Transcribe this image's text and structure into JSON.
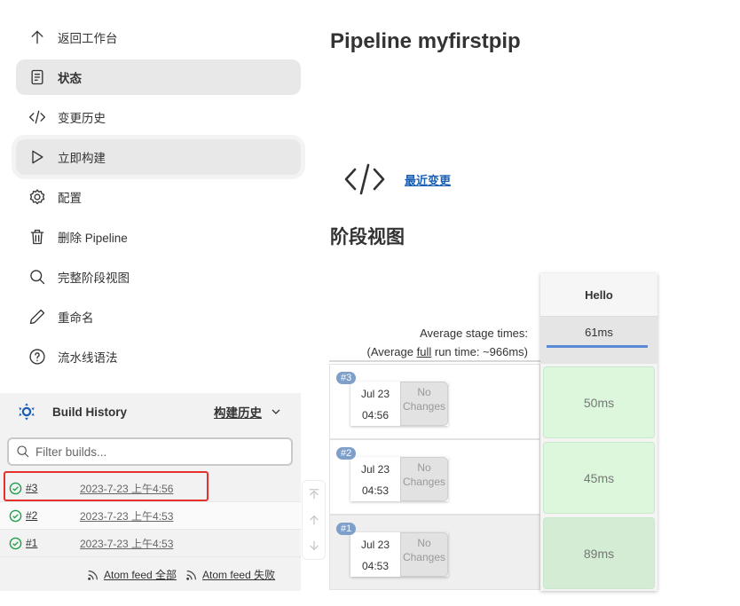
{
  "sidebar": {
    "items": [
      {
        "label": "返回工作台",
        "icon": "arrow-up-icon"
      },
      {
        "label": "状态",
        "icon": "document-icon",
        "active": true
      },
      {
        "label": "变更历史",
        "icon": "code-icon"
      },
      {
        "label": "立即构建",
        "icon": "play-icon"
      },
      {
        "label": "配置",
        "icon": "gear-icon"
      },
      {
        "label": "删除 Pipeline",
        "icon": "trash-icon"
      },
      {
        "label": "完整阶段视图",
        "icon": "search-icon"
      },
      {
        "label": "重命名",
        "icon": "pencil-icon"
      },
      {
        "label": "流水线语法",
        "icon": "help-circle-icon"
      }
    ]
  },
  "build_history": {
    "title": "Build History",
    "trend_label": "构建历史",
    "filter_placeholder": "Filter builds...",
    "builds": [
      {
        "number": "#3",
        "date": "2023-7-23 上午4:56",
        "status": "success"
      },
      {
        "number": "#2",
        "date": "2023-7-23 上午4:53",
        "status": "success"
      },
      {
        "number": "#1",
        "date": "2023-7-23 上午4:53",
        "status": "success"
      }
    ],
    "feeds": [
      "Atom feed 全部",
      "Atom feed 失败"
    ]
  },
  "main": {
    "title": "Pipeline myfirstpip",
    "recent_changes": "最近变更",
    "stage_view_title": "阶段视图"
  },
  "stage_view": {
    "avg_label": "Average stage times:",
    "avg_full_prefix": "(Average ",
    "avg_full_word": "full",
    "avg_full_suffix": " run time: ~966ms)",
    "stages": [
      {
        "name": "Hello",
        "avg": "61ms",
        "avg_fraction": 1.0
      }
    ],
    "runs": [
      {
        "badge": "#3",
        "date": "Jul 23",
        "time": "04:56",
        "changes": "No Changes",
        "durations": [
          "50ms"
        ]
      },
      {
        "badge": "#2",
        "date": "Jul 23",
        "time": "04:53",
        "changes": "No Changes",
        "durations": [
          "45ms"
        ]
      },
      {
        "badge": "#1",
        "date": "Jul 23",
        "time": "04:53",
        "changes": "No Changes",
        "durations": [
          "89ms"
        ]
      }
    ]
  },
  "colors": {
    "accent_link": "#1a5fb4",
    "success_green": "#1e9e4a",
    "highlight_red": "#e53030",
    "stage_success_bg": "#ddf7dd",
    "progress_blue": "#5b8ad6"
  }
}
